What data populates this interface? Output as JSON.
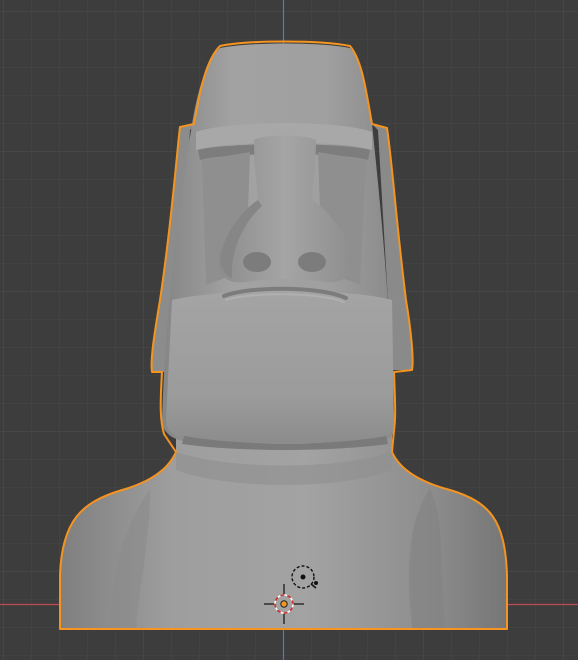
{
  "viewport": {
    "view": "front-orthographic",
    "background_color": "#3d3d3d",
    "grid_minor_color": "#474747",
    "grid_major_color": "#4f4f4f",
    "x_axis_color": "#c04a52",
    "z_axis_color": "#4f7bbf",
    "selection_outline_color": "#f5941f"
  },
  "object": {
    "name": "moai-statue",
    "selected": true,
    "surface_color": "#9a9a9a"
  },
  "overlays": {
    "cursor_icon": "3d-cursor-icon",
    "origin_icon": "object-origin-icon",
    "light_icon": "light-gizmo-icon"
  }
}
